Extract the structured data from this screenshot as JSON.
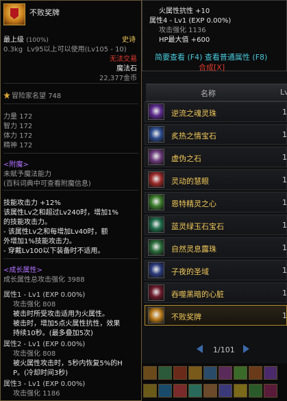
{
  "tooltip": {
    "name": "不败奖牌",
    "grade": "最上级",
    "grade_pct": "(100%)",
    "rarity": "史诗",
    "weight": "0.3kg",
    "level_req": "Lv95以上可以使用(Lv105 - 10)",
    "untradable": "无法交易",
    "category": "魔法石",
    "price": "22,377金币",
    "fame_label": "冒险家名望",
    "fame_value": "748",
    "stats": [
      {
        "label": "力量",
        "value": "172"
      },
      {
        "label": "智力",
        "value": "172"
      },
      {
        "label": "体力",
        "value": "172"
      },
      {
        "label": "精神",
        "value": "172"
      }
    ],
    "enchant_header": "<附魔>",
    "enchant_line1": "未赋予魔法能力",
    "enchant_line2": "(百科词典中可查看附魔信息)",
    "effect_lines": [
      "技能攻击力 +12%",
      "该属性Lv之和超过Lv240时，增加1%",
      "的技能攻击力。",
      "- 该属性Lv之和每增加Lv40时，额",
      "外增加1%技能攻击力。",
      "- 穿戴Lv100以下装备时不适用。"
    ],
    "growth_header": "<成长属性>",
    "growth_total": "成长属性总攻击强化 3988",
    "growth": [
      {
        "title": "属性1 - Lv1 (EXP 0.00%)",
        "lines": [
          "攻击强化 808",
          "被击时所受攻击适用为火属性。",
          "被击时，增加5点火属性抗性，效果",
          "持续10秒。(最多叠加5次)"
        ]
      },
      {
        "title": "属性2 - Lv1 (EXP 0.00%)",
        "lines": [
          "攻击强化 808",
          "被火属性攻击时，5秒内恢复5%的H",
          "P。(冷却时间3秒)"
        ]
      },
      {
        "title": "属性3 - Lv1 (EXP 0.00%)",
        "lines": [
          "攻击强化 1186"
        ]
      }
    ]
  },
  "detail": {
    "line1": "火属性抗性 +10",
    "line2": "属性4 - Lv1 (EXP 0.00%)",
    "line3": "攻击强化 1136",
    "line4": "HP最大值 +600",
    "links": "简要查看 (F4) 查看普通属性 (F8)",
    "link_red": "合成[X]"
  },
  "list": {
    "col_name": "名称",
    "col_lv": "Lv",
    "items": [
      {
        "name": "逆流之魂灵珠",
        "lv": "1",
        "color": "#f0c85a",
        "icon": "purple-orb-icon",
        "bg": "#5a2a8a"
      },
      {
        "name": "炙热之情宝石",
        "lv": "1",
        "color": "#f0c85a",
        "icon": "blue-gem-icon",
        "bg": "#2b4a8c"
      },
      {
        "name": "虚伪之石",
        "lv": "1",
        "color": "#f0c85a",
        "icon": "skull-stone-icon",
        "bg": "#6a3a7a"
      },
      {
        "name": "灵动的慧眼",
        "lv": "1",
        "color": "#f0c85a",
        "icon": "eye-orb-icon",
        "bg": "#9a2a2a"
      },
      {
        "name": "恩特精灵之心",
        "lv": "1",
        "color": "#f0c85a",
        "icon": "sprite-heart-icon",
        "bg": "#3a7a2a"
      },
      {
        "name": "蓝灵绿玉石宝石",
        "lv": "1",
        "color": "#f0c85a",
        "icon": "green-gem-icon",
        "bg": "#1e6a4a"
      },
      {
        "name": "自然灵息露珠",
        "lv": "1",
        "color": "#f0c85a",
        "icon": "dew-drop-icon",
        "bg": "#2a6a3a"
      },
      {
        "name": "子夜的圣域",
        "lv": "1",
        "color": "#f0c85a",
        "icon": "sanctuary-icon",
        "bg": "#2a3a7a"
      },
      {
        "name": "吞噬黑暗的心脏",
        "lv": "1",
        "color": "#f0c85a",
        "icon": "dark-heart-icon",
        "bg": "#6a1a2a"
      },
      {
        "name": "不败奖牌",
        "lv": "1",
        "color": "#f0c85a",
        "icon": "medal-icon",
        "bg": "#b87a1a"
      }
    ],
    "pager": "1/101"
  }
}
